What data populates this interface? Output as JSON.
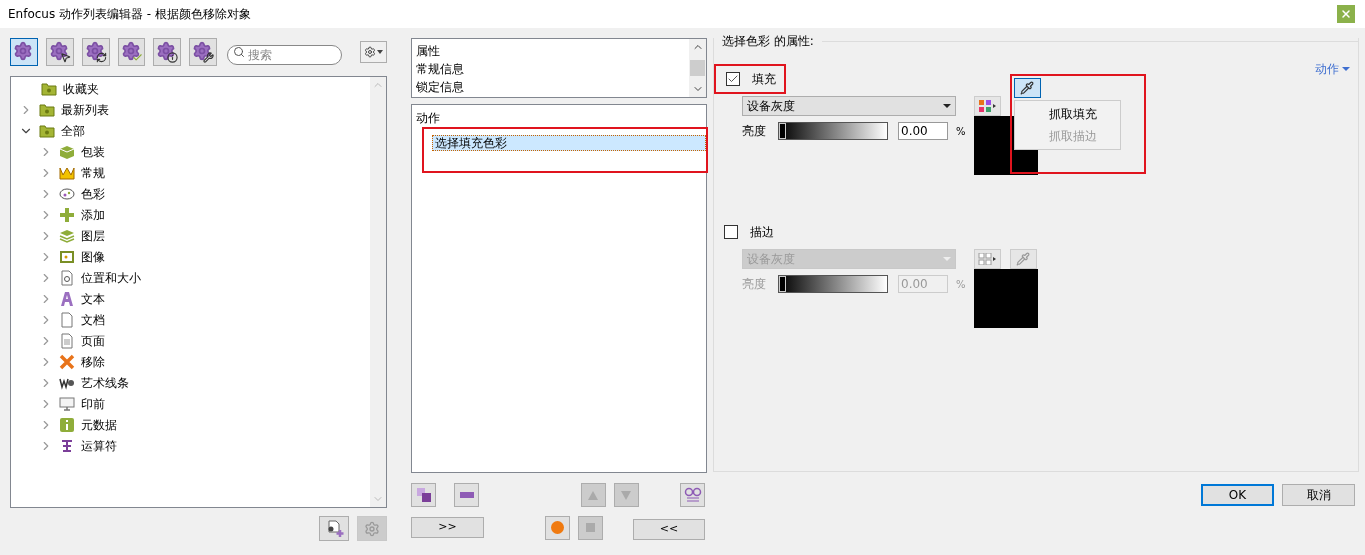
{
  "window": {
    "title": "Enfocus 动作列表编辑器 - 根据颜色移除对象"
  },
  "toolbar": {
    "buttons": [
      {
        "selected": true
      },
      {
        "selected": false
      },
      {
        "selected": false
      },
      {
        "selected": false
      },
      {
        "selected": false
      },
      {
        "selected": false
      }
    ],
    "search": {
      "placeholder": "搜索"
    }
  },
  "tree": [
    {
      "label": "收藏夹"
    },
    {
      "label": "最新列表",
      "expanded": false
    },
    {
      "label": "全部",
      "expanded": true,
      "children": [
        {
          "label": "包装",
          "expanded": false
        },
        {
          "label": "常规",
          "expanded": false
        },
        {
          "label": "色彩",
          "expanded": false
        },
        {
          "label": "添加",
          "expanded": false
        },
        {
          "label": "图层",
          "expanded": false
        },
        {
          "label": "图像",
          "expanded": false
        },
        {
          "label": "位置和大小",
          "expanded": false
        },
        {
          "label": "文本",
          "expanded": false
        },
        {
          "label": "文档",
          "expanded": false
        },
        {
          "label": "页面",
          "expanded": false
        },
        {
          "label": "移除",
          "expanded": false
        },
        {
          "label": "艺术线条",
          "expanded": false
        },
        {
          "label": "印前",
          "expanded": false
        },
        {
          "label": "元数据",
          "expanded": false
        },
        {
          "label": "运算符",
          "expanded": false
        }
      ]
    }
  ],
  "info_list": [
    "属性",
    "常规信息",
    "锁定信息"
  ],
  "actions": {
    "header": "动作",
    "items": [
      {
        "label": "选择填充色彩",
        "selected": true
      }
    ]
  },
  "middle_buttons": {
    "forward": ">>",
    "back": "<<"
  },
  "properties": {
    "title": "选择色彩 的属性:",
    "menu_link": "动作",
    "sections": [
      {
        "label": "填充",
        "checked": true,
        "color_space": "设备灰度",
        "slider_label": "亮度",
        "level": 0,
        "value": "0.00",
        "unit": "%",
        "menu_open": true,
        "menu": [
          {
            "label": "抓取填充",
            "disabled": false
          },
          {
            "label": "抓取描边",
            "disabled": true
          }
        ]
      },
      {
        "label": "描边",
        "checked": false,
        "color_space": "设备灰度",
        "slider_label": "亮度",
        "level": 0,
        "value": "0.00",
        "unit": "%",
        "menu_open": false
      }
    ]
  },
  "footer": {
    "ok": "OK",
    "cancel": "取消"
  }
}
